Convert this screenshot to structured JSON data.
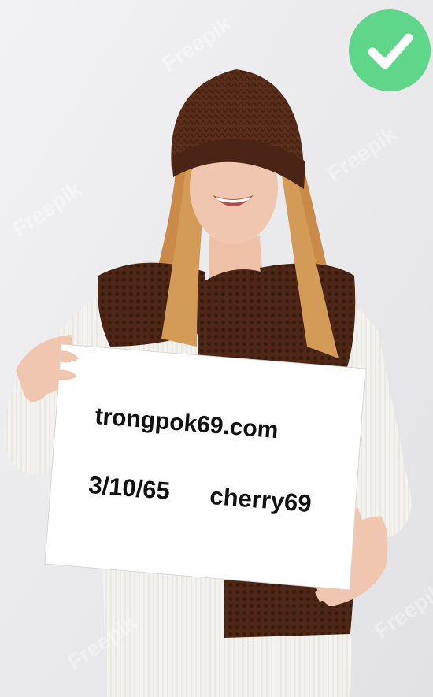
{
  "sign": {
    "line1": "trongpok69.com",
    "line2_date": "3/10/65",
    "line2_name": "cherry69"
  },
  "watermark": {
    "text": "Freepik"
  },
  "badge": {
    "icon": "check-icon",
    "color": "#5fd68a"
  },
  "colors": {
    "background": "#e9e9ec",
    "hat": "#5a2e1a",
    "scarf": "#4e2716",
    "sweater": "#f4f2ee",
    "hair": "#c98a4a",
    "skin": "#f1c6b0",
    "sign": "#ffffff"
  }
}
